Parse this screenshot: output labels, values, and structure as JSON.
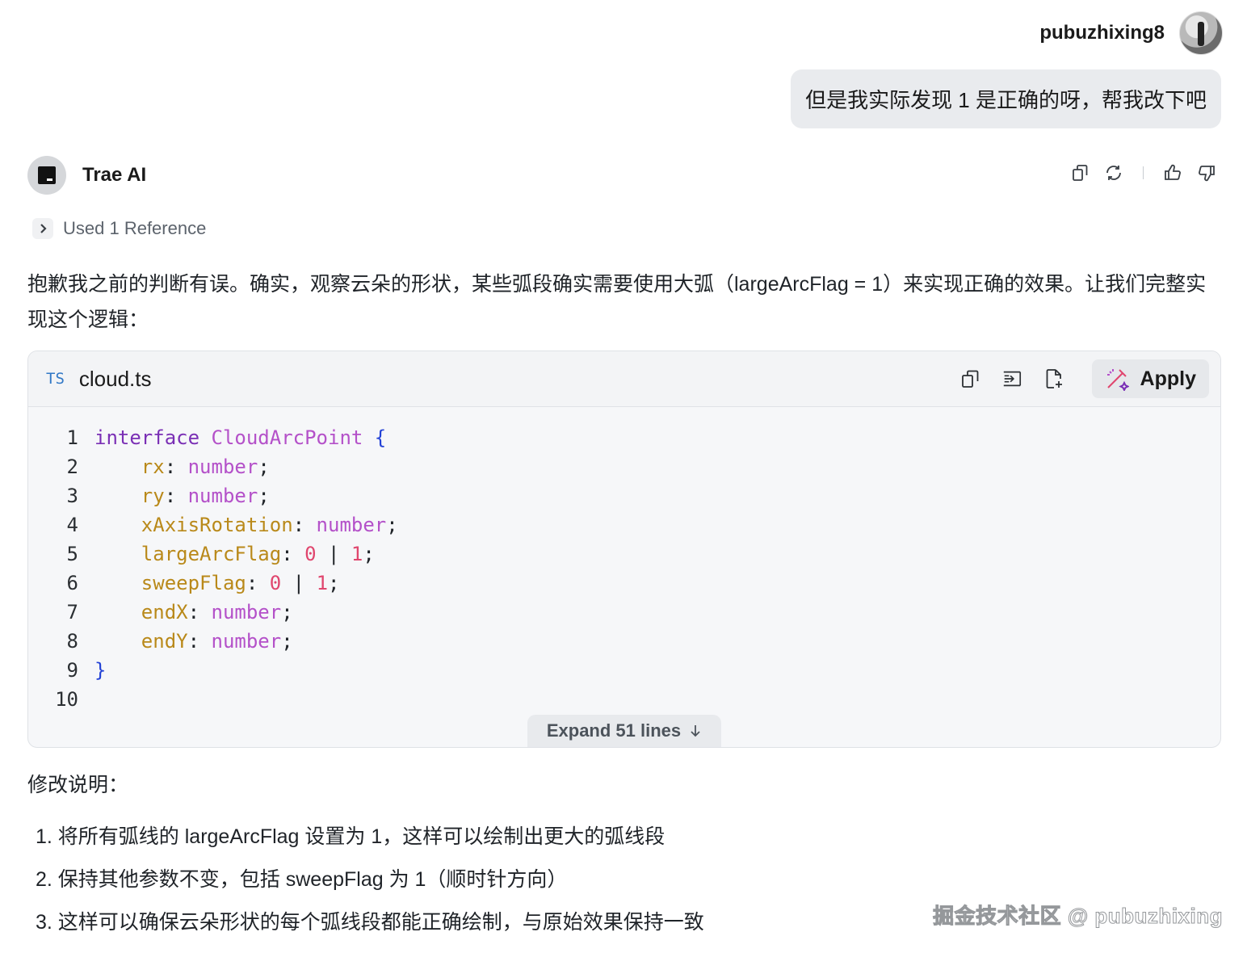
{
  "user": {
    "name": "pubuzhixing8",
    "message": "但是我实际发现 1 是正确的呀，帮我改下吧"
  },
  "assistant": {
    "name": "Trae AI",
    "reference_label": "Used 1 Reference",
    "intro": "抱歉我之前的判断有误。确实，观察云朵的形状，某些弧段确实需要使用大弧（largeArcFlag = 1）来实现正确的效果。让我们完整实现这个逻辑："
  },
  "code_block": {
    "language_badge": "TS",
    "file_name": "cloud.ts",
    "apply_label": "Apply",
    "expand_label": "Expand 51 lines",
    "line_numbers": [
      "1",
      "2",
      "3",
      "4",
      "5",
      "6",
      "7",
      "8",
      "9",
      "10"
    ]
  },
  "notes": {
    "title": "修改说明：",
    "items": [
      "1. 将所有弧线的 largeArcFlag 设置为 1，这样可以绘制出更大的弧线段",
      "2. 保持其他参数不变，包括 sweepFlag 为 1（顺时针方向）",
      "3. 这样可以确保云朵形状的每个弧线段都能正确绘制，与原始效果保持一致"
    ]
  },
  "watermark": "掘金技术社区 @ pubuzhixing",
  "icons": {
    "copy": "copy-icon",
    "regenerate": "refresh-icon",
    "like": "thumbs-up-icon",
    "dislike": "thumbs-down-icon",
    "insert": "insert-at-cursor-icon",
    "new_file": "new-file-icon",
    "apply": "magic-wand-icon",
    "chevron": "chevron-right-icon",
    "arrow_down": "arrow-down-icon"
  },
  "colors": {
    "keyword": "#7a2fb5",
    "type": "#b451c9",
    "property": "#b9891a",
    "brace": "#2342d6",
    "number": "#e0466e",
    "ts_badge": "#3178c6"
  }
}
